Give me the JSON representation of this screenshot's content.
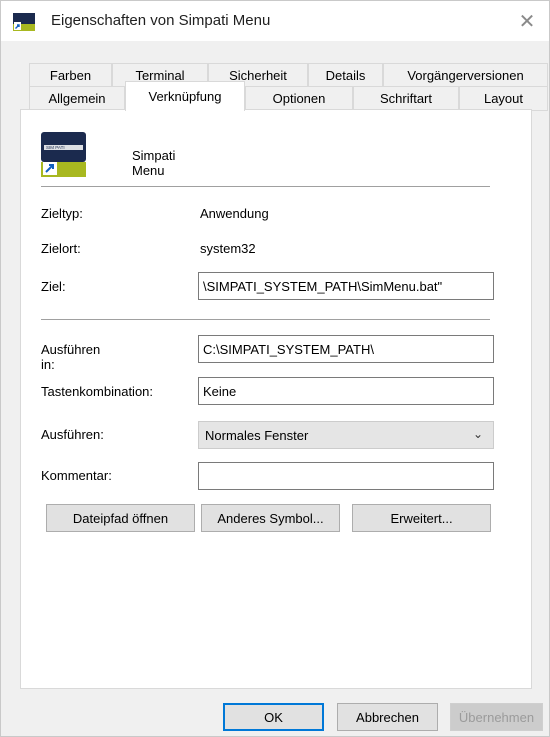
{
  "window": {
    "title": "Eigenschaften von Simpati Menu"
  },
  "tabs_row1": [
    "Farben",
    "Terminal",
    "Sicherheit",
    "Details",
    "Vorgängerversionen"
  ],
  "tabs_row2": [
    "Allgemein",
    "Verknüpfung",
    "Optionen",
    "Schriftart",
    "Layout"
  ],
  "active_tab": "Verknüpfung",
  "shortcut": {
    "name": "Simpati Menu",
    "icon_text": "SIM PATI",
    "zieltyp_label": "Zieltyp:",
    "zieltyp_value": "Anwendung",
    "zielort_label": "Zielort:",
    "zielort_value": "system32",
    "ziel_label": "Ziel:",
    "ziel_value": "\\SIMPATI_SYSTEM_PATH\\SimMenu.bat\"",
    "ausfuehren_in_label": "Ausführen in:",
    "ausfuehren_in_value": "C:\\SIMPATI_SYSTEM_PATH\\",
    "tasten_label": "Tastenkombination:",
    "tasten_value": "Keine",
    "ausfuehren_label": "Ausführen:",
    "ausfuehren_value": "Normales Fenster",
    "kommentar_label": "Kommentar:",
    "kommentar_value": ""
  },
  "buttons": {
    "dateipfad": "Dateipfad öffnen",
    "symbol": "Anderes Symbol...",
    "erweitert": "Erweitert...",
    "ok": "OK",
    "abbrechen": "Abbrechen",
    "uebernehmen": "Übernehmen"
  },
  "colors": {
    "accent": "#0078d7",
    "icon_navy": "#1b2a4e",
    "icon_green": "#a8b820"
  }
}
